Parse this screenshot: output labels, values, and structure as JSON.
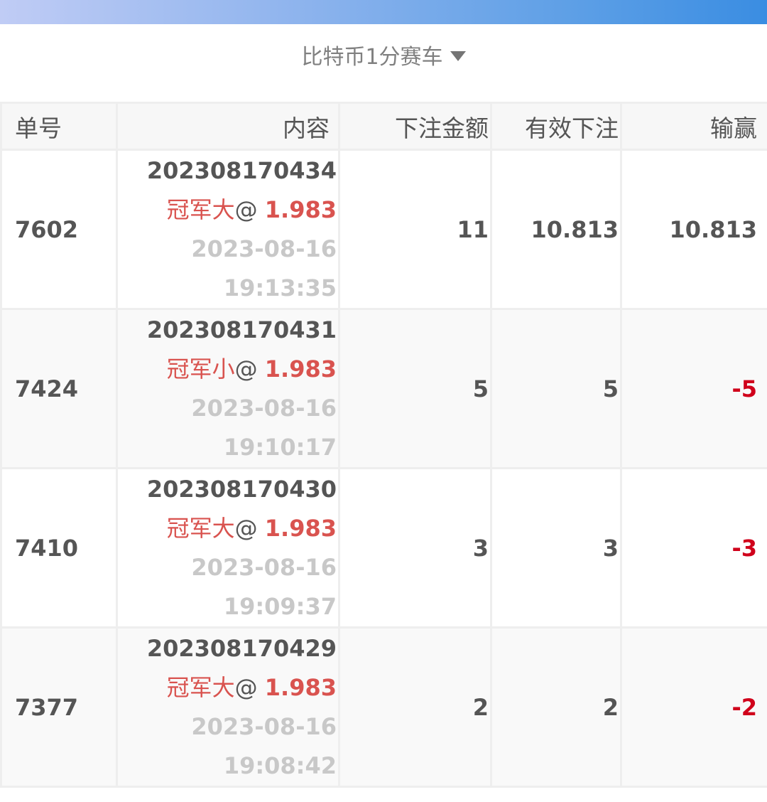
{
  "header": {
    "lottery_name": "比特币1分赛车",
    "dropdown_icon": "caret-down-icon"
  },
  "colors": {
    "accent_gradient_start": "#c0ccf5",
    "accent_gradient_end": "#3a8de2",
    "bet_red": "#d9534f",
    "loss_red": "#d0011b"
  },
  "table": {
    "columns": [
      "单号",
      "内容",
      "下注金额",
      "有效下注",
      "输赢"
    ],
    "rows": [
      {
        "id": "7602",
        "issue": "202308170434",
        "play": "冠军大",
        "at": "@ ",
        "odds": "1.983",
        "date": "2023-08-16",
        "time": "19:13:35",
        "amount": "11",
        "valid": "10.813",
        "result": "10.813",
        "result_negative": false
      },
      {
        "id": "7424",
        "issue": "202308170431",
        "play": "冠军小",
        "at": "@ ",
        "odds": "1.983",
        "date": "2023-08-16",
        "time": "19:10:17",
        "amount": "5",
        "valid": "5",
        "result": "-5",
        "result_negative": true
      },
      {
        "id": "7410",
        "issue": "202308170430",
        "play": "冠军大",
        "at": "@ ",
        "odds": "1.983",
        "date": "2023-08-16",
        "time": "19:09:37",
        "amount": "3",
        "valid": "3",
        "result": "-3",
        "result_negative": true
      },
      {
        "id": "7377",
        "issue": "202308170429",
        "play": "冠军大",
        "at": "@ ",
        "odds": "1.983",
        "date": "2023-08-16",
        "time": "19:08:42",
        "amount": "2",
        "valid": "2",
        "result": "-2",
        "result_negative": true
      }
    ]
  }
}
